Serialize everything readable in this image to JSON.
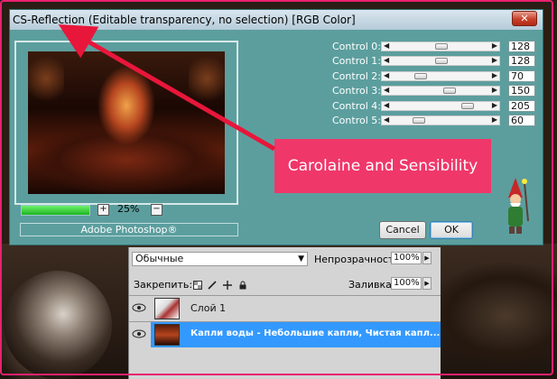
{
  "dialog": {
    "title": "CS-Reflection (Editable transparency, no selection) [RGB Color]",
    "close_icon": "close-icon",
    "zoom": "25%",
    "brand": "Adobe Photoshop®",
    "controls": [
      {
        "label": "Control 0:",
        "value": "128",
        "level": 0.5
      },
      {
        "label": "Control 1:",
        "value": "128",
        "level": 0.5
      },
      {
        "label": "Control 2:",
        "value": "70",
        "level": 0.27
      },
      {
        "label": "Control 3:",
        "value": "150",
        "level": 0.59
      },
      {
        "label": "Control 4:",
        "value": "205",
        "level": 0.8
      },
      {
        "label": "Control 5:",
        "value": "60",
        "level": 0.24
      }
    ],
    "cancel_label": "Cancel",
    "ok_label": "OK"
  },
  "callout": {
    "text": "Carolaine and Sensibility",
    "color": "#f0376a"
  },
  "layers": {
    "blend_mode": "Обычные",
    "opacity_label": "Непрозрачность:",
    "opacity_value": "100%",
    "lock_label": "Закрепить:",
    "fill_label": "Заливка:",
    "fill_value": "100%",
    "items": [
      {
        "name": "Слой 1",
        "selected": false
      },
      {
        "name": "Капли воды - Небольшие капли, Чистая капл...",
        "selected": true
      }
    ]
  },
  "colors": {
    "dialog_bg": "#5c9e9e",
    "selection": "#3399ff",
    "frame": "#e8216f"
  }
}
